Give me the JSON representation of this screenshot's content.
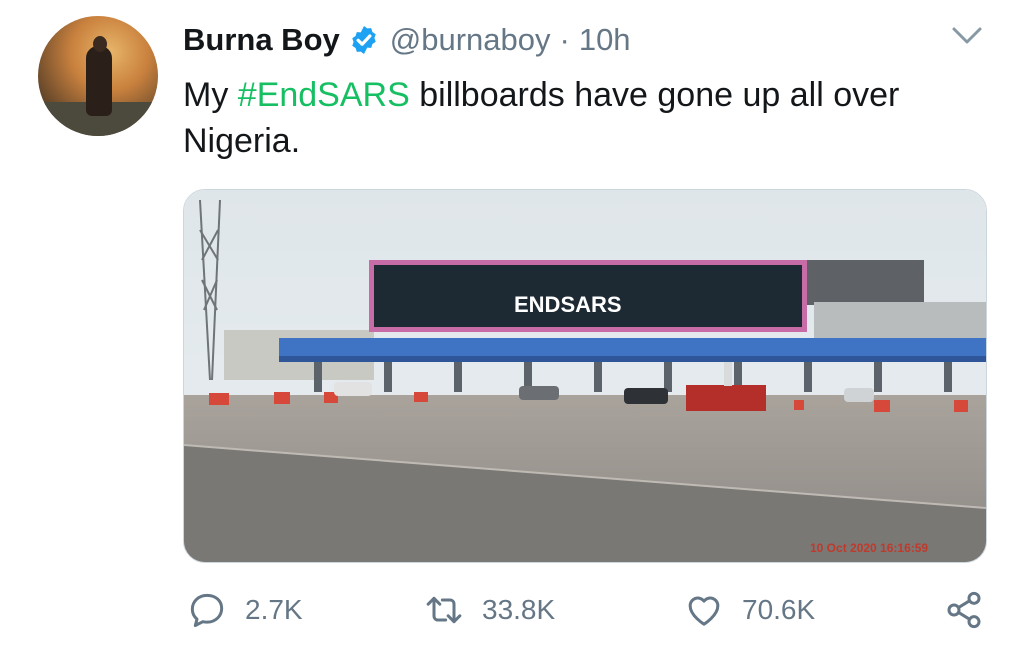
{
  "tweet": {
    "author_name": "Burna Boy",
    "handle": "@burnaboy",
    "separator": "·",
    "time": "10h",
    "text_before": "My ",
    "hashtag": "#EndSARS",
    "text_after": " billboards have gone up all over Nigeria."
  },
  "media": {
    "billboard_text": "ENDSARS",
    "timestamp": "10 Oct 2020 16:16:59"
  },
  "actions": {
    "replies": "2.7K",
    "retweets": "33.8K",
    "likes": "70.6K"
  },
  "colors": {
    "hashtag": "#17bf63",
    "verified": "#1da1f2",
    "muted": "#657786"
  },
  "icons": [
    "verified-badge-icon",
    "chevron-down-icon",
    "reply-icon",
    "retweet-icon",
    "like-icon",
    "share-icon"
  ]
}
